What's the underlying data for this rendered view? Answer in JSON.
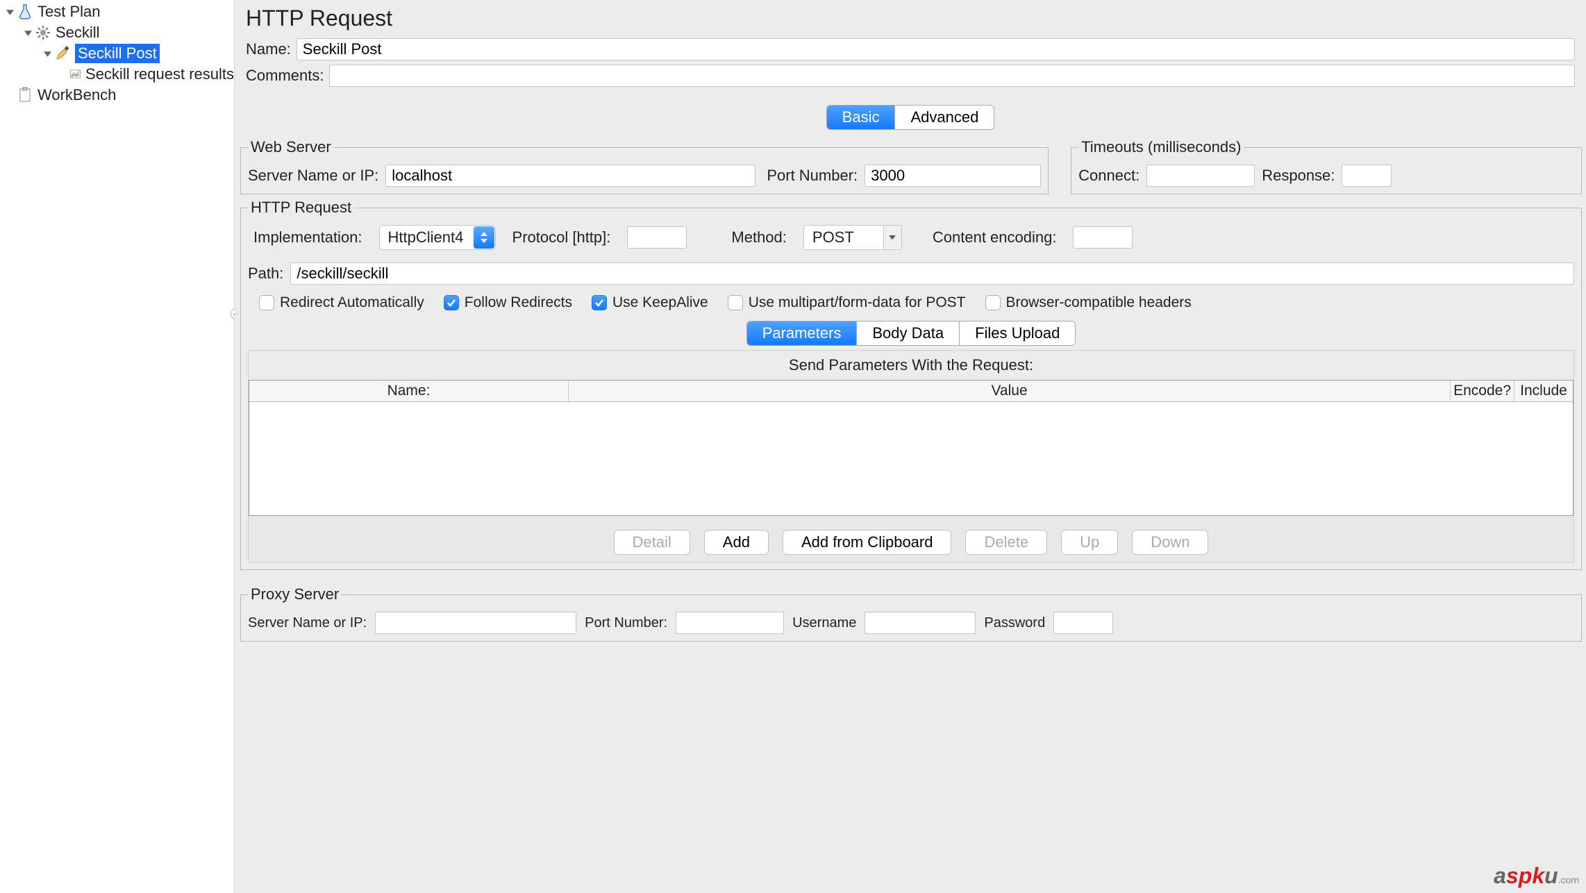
{
  "tree": {
    "testPlan": "Test Plan",
    "seckill": "Seckill",
    "seckillPost": "Seckill Post",
    "seckillResults": "Seckill request results",
    "workbench": "WorkBench"
  },
  "main": {
    "title": "HTTP Request",
    "nameLabel": "Name:",
    "nameValue": "Seckill Post",
    "commentsLabel": "Comments:",
    "commentsValue": "",
    "tabs": {
      "basic": "Basic",
      "advanced": "Advanced"
    }
  },
  "webServer": {
    "legend": "Web Server",
    "serverLabel": "Server Name or IP:",
    "serverValue": "localhost",
    "portLabel": "Port Number:",
    "portValue": "3000"
  },
  "timeouts": {
    "legend": "Timeouts (milliseconds)",
    "connectLabel": "Connect:",
    "connectValue": "",
    "responseLabel": "Response:",
    "responseValue": ""
  },
  "httpReq": {
    "legend": "HTTP Request",
    "implLabel": "Implementation:",
    "implValue": "HttpClient4",
    "protocolLabel": "Protocol [http]:",
    "protocolValue": "",
    "methodLabel": "Method:",
    "methodValue": "POST",
    "contentLabel": "Content encoding:",
    "contentValue": "",
    "pathLabel": "Path:",
    "pathValue": "/seckill/seckill"
  },
  "checkboxes": {
    "redirect": "Redirect Automatically",
    "follow": "Follow Redirects",
    "keepalive": "Use KeepAlive",
    "multipart": "Use multipart/form-data for POST",
    "browser": "Browser-compatible headers"
  },
  "innerTabs": {
    "params": "Parameters",
    "body": "Body Data",
    "files": "Files Upload"
  },
  "paramsTable": {
    "title": "Send Parameters With the Request:",
    "cols": {
      "name": "Name:",
      "value": "Value",
      "encode": "Encode?",
      "include": "Include"
    }
  },
  "buttons": {
    "detail": "Detail",
    "add": "Add",
    "clipboard": "Add from Clipboard",
    "delete": "Delete",
    "up": "Up",
    "down": "Down"
  },
  "proxy": {
    "legend": "Proxy Server",
    "serverLabel": "Server Name or IP:",
    "serverValue": "",
    "portLabel": "Port Number:",
    "portValue": "",
    "userLabel": "Username",
    "userValue": "",
    "passLabel": "Password",
    "passValue": ""
  },
  "watermark": {
    "a": "a",
    "spk": "spk",
    "u": "u",
    "com": ".com"
  }
}
